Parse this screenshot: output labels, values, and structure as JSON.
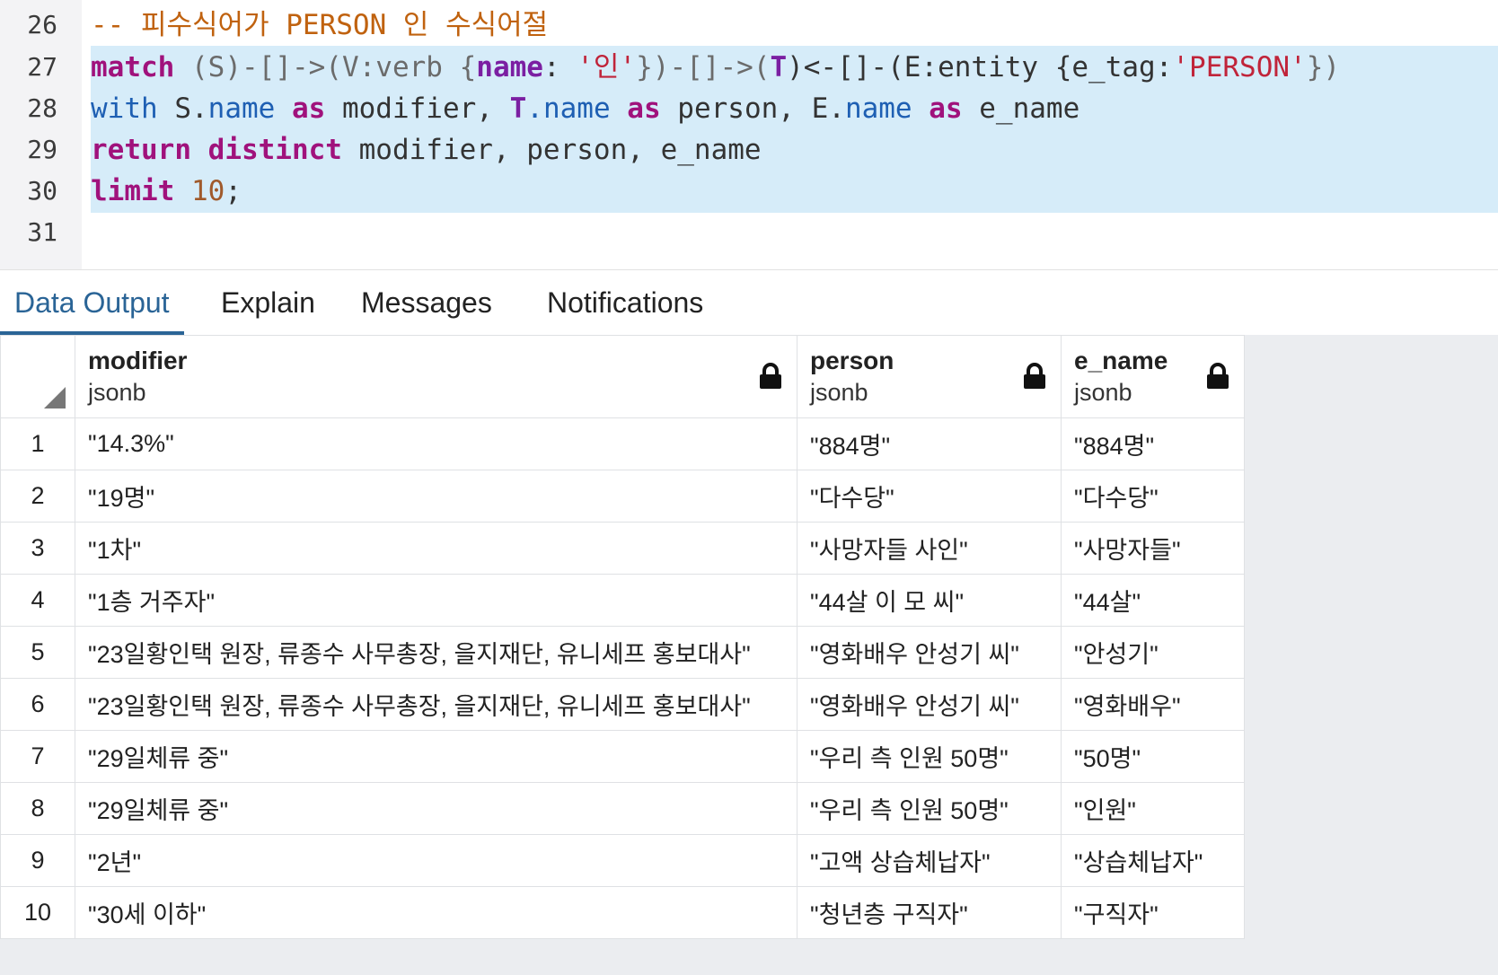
{
  "editor": {
    "lines": [
      {
        "num": "26"
      },
      {
        "num": "27"
      },
      {
        "num": "28"
      },
      {
        "num": "29"
      },
      {
        "num": "30"
      },
      {
        "num": "31"
      }
    ],
    "line26": {
      "comment": "-- 피수식어가 PERSON 인 수식어절"
    },
    "line27": {
      "kw_match": "match",
      "p1": " (S)-[]->(V:verb {",
      "prop_name": "name",
      "p2": ": ",
      "str1": "'인'",
      "p3": "})-[]->(",
      "var_t": "T",
      "p4": ")<-[]-(E:entity {e_tag:",
      "str2": "'PERSON'",
      "p5": "})"
    },
    "line28": {
      "kw_with": "with",
      "p1": " S.",
      "prop1": "name",
      "p2": " ",
      "kw_as1": "as",
      "p3": " modifier, ",
      "var_t": "T",
      "p4": ".",
      "prop2": "name",
      "p5": " ",
      "kw_as2": "as",
      "p6": " person, E.",
      "prop3": "name",
      "p7": " ",
      "kw_as3": "as",
      "p8": " e_name"
    },
    "line29": {
      "kw_return": "return",
      "p1": " ",
      "kw_distinct": "distinct",
      "p2": " modifier, person, e_name"
    },
    "line30": {
      "kw_limit": "limit",
      "p1": " ",
      "num": "10",
      "p2": ";"
    }
  },
  "tabs": [
    {
      "label": "Data Output",
      "active": true
    },
    {
      "label": "Explain",
      "active": false
    },
    {
      "label": "Messages",
      "active": false
    },
    {
      "label": "Notifications",
      "active": false
    }
  ],
  "grid": {
    "columns": [
      {
        "name": "modifier",
        "type": "jsonb"
      },
      {
        "name": "person",
        "type": "jsonb"
      },
      {
        "name": "e_name",
        "type": "jsonb"
      }
    ],
    "rows": [
      {
        "n": "1",
        "modifier": "\"14.3%\"",
        "person": "\"884명\"",
        "e_name": "\"884명\""
      },
      {
        "n": "2",
        "modifier": "\"19명\"",
        "person": "\"다수당\"",
        "e_name": "\"다수당\""
      },
      {
        "n": "3",
        "modifier": "\"1차\"",
        "person": "\"사망자들 사인\"",
        "e_name": "\"사망자들\""
      },
      {
        "n": "4",
        "modifier": "\"1층 거주자\"",
        "person": "\"44살 이 모 씨\"",
        "e_name": "\"44살\""
      },
      {
        "n": "5",
        "modifier": "\"23일황인택 원장, 류종수 사무총장, 을지재단, 유니세프 홍보대사\"",
        "person": "\"영화배우 안성기 씨\"",
        "e_name": "\"안성기\""
      },
      {
        "n": "6",
        "modifier": "\"23일황인택 원장, 류종수 사무총장, 을지재단, 유니세프 홍보대사\"",
        "person": "\"영화배우 안성기 씨\"",
        "e_name": "\"영화배우\""
      },
      {
        "n": "7",
        "modifier": "\"29일체류 중\"",
        "person": "\"우리 측 인원 50명\"",
        "e_name": "\"50명\""
      },
      {
        "n": "8",
        "modifier": "\"29일체류 중\"",
        "person": "\"우리 측 인원 50명\"",
        "e_name": "\"인원\""
      },
      {
        "n": "9",
        "modifier": "\"2년\"",
        "person": "\"고액 상습체납자\"",
        "e_name": "\"상습체납자\""
      },
      {
        "n": "10",
        "modifier": "\"30세 이하\"",
        "person": "\"청년층 구직자\"",
        "e_name": "\"구직자\""
      }
    ]
  }
}
